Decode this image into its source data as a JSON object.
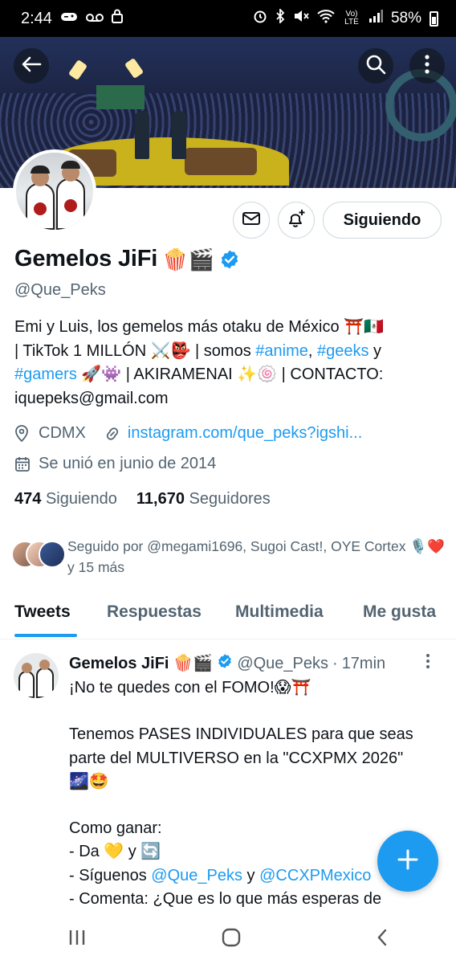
{
  "status_bar": {
    "time": "2:44",
    "battery": "58%",
    "volte": "Vo) LTE"
  },
  "profile": {
    "display_name": "Gemelos JiFi",
    "name_emoji": "🍿🎬",
    "handle": "@Que_Peks",
    "follow_button": "Siguiendo",
    "bio": {
      "line1": "Emi y Luis, los gemelos más otaku de México ⛩️🇲🇽",
      "line2_a": "| TikTok 1 MILLÓN ⚔️👺 | somos ",
      "tag_anime": "#anime",
      "sep1": ", ",
      "tag_geeks": "#geeks",
      "line2_b": " y",
      "tag_gamers": "#gamers",
      "line3_b": " 🚀👾 | AKIRAMENAI ✨🍥 | CONTACTO:",
      "line4": "iquepeks@gmail.com"
    },
    "location": "CDMX",
    "website": "instagram.com/que_peks?igshi...",
    "joined": "Se unió en junio de 2014",
    "following_count": "474",
    "following_label": "Siguiendo",
    "followers_count": "11,670",
    "followers_label": "Seguidores",
    "followed_by": "Seguido por @megami1696, Sugoi Cast!, OYE Cortex 🎙️❤️ y 15 más"
  },
  "tabs": [
    {
      "label": "Tweets",
      "active": true
    },
    {
      "label": "Respuestas",
      "active": false
    },
    {
      "label": "Multimedia",
      "active": false
    },
    {
      "label": "Me gusta",
      "active": false
    }
  ],
  "tweet": {
    "name": "Gemelos JiFi",
    "name_emoji": "🍿🎬",
    "handle": "@Que_Peks",
    "dot": "·",
    "time": "17min",
    "lines": {
      "l1": "¡No te quedes con el FOMO!😱⛩️",
      "l2": "Tenemos PASES INDIVIDUALES para que seas",
      "l3": "parte del MULTIVERSO en la \"CCXPMX 2026\"",
      "l4": "🌌🤩",
      "l5": "Como ganar:",
      "l6": "- Da 💛 y 🔄",
      "l7_a": "- Síguenos ",
      "l7_link1": "@Que_Peks",
      "l7_b": " y ",
      "l7_link2": "@CCXPMexico",
      "l8": "- Comenta:  ¿Que es lo que más esperas de"
    }
  },
  "colors": {
    "accent": "#1d9bf0",
    "text_primary": "#0f1419",
    "text_secondary": "#536471",
    "border": "#cfd9de"
  },
  "icons": [
    "back-arrow-icon",
    "search-icon",
    "more-vertical-icon",
    "mail-icon",
    "bell-plus-icon",
    "verified-badge-icon",
    "location-icon",
    "link-icon",
    "calendar-icon",
    "plus-icon",
    "recent-apps-icon",
    "home-icon",
    "back-icon"
  ]
}
